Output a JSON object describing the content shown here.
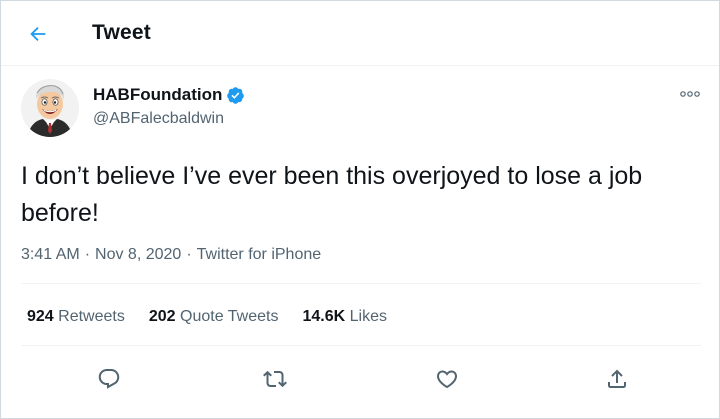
{
  "header": {
    "title": "Tweet"
  },
  "author": {
    "display_name": "HABFoundation",
    "handle": "@ABFalecbaldwin",
    "verified": true
  },
  "tweet": {
    "text": "I don’t believe I’ve ever been this overjoyed to lose a job before!",
    "time": "3:41 AM",
    "date": "Nov 8, 2020",
    "source": "Twitter for iPhone",
    "separator": "·"
  },
  "stats": {
    "retweets_count": "924",
    "retweets_label": "Retweets",
    "quotes_count": "202",
    "quotes_label": "Quote Tweets",
    "likes_count": "14.6K",
    "likes_label": "Likes"
  },
  "colors": {
    "accent": "#1d9bf0",
    "text_primary": "#0f1419",
    "text_secondary": "#536471",
    "divider": "#eff3f4"
  },
  "icons": {
    "back": "arrow-left-icon",
    "verified": "verified-badge-icon",
    "more": "more-icon",
    "reply": "reply-icon",
    "retweet": "retweet-icon",
    "like": "heart-icon",
    "share": "share-icon"
  }
}
